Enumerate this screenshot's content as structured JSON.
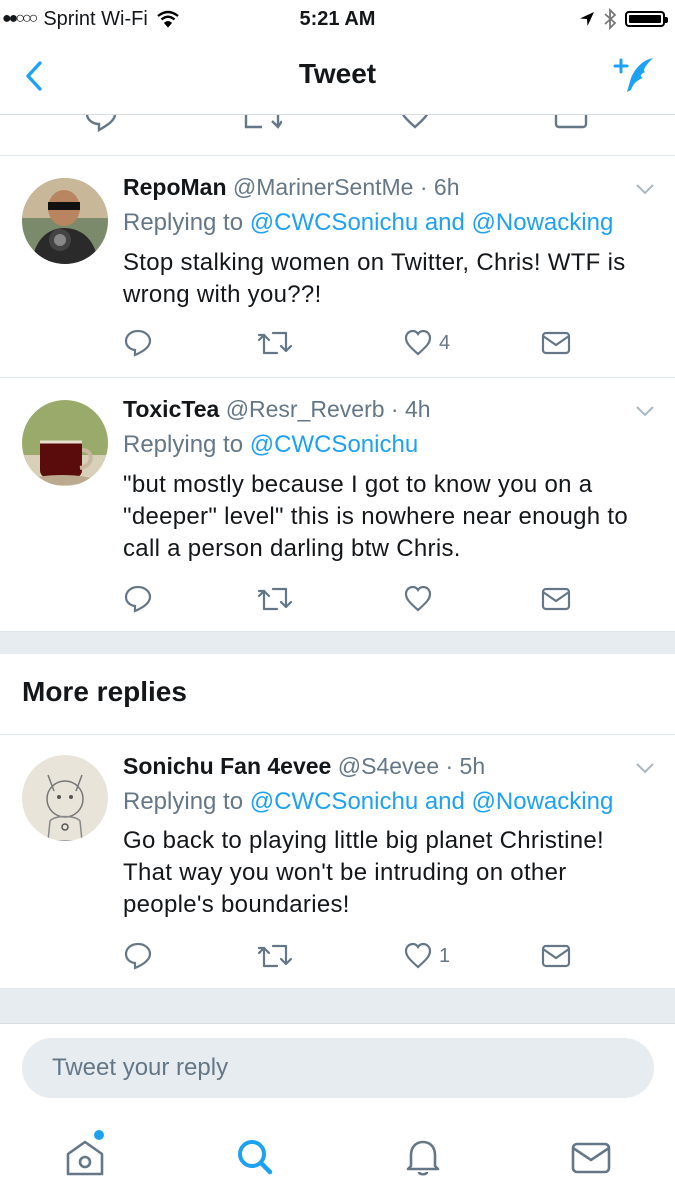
{
  "status_bar": {
    "carrier": "Sprint Wi-Fi",
    "time": "5:21 AM"
  },
  "nav": {
    "title": "Tweet"
  },
  "tweets": [
    {
      "name": "RepoMan",
      "handle": "@MarinerSentMe",
      "time": "· 6h",
      "replying_prefix": "Replying to ",
      "replying_to": "@CWCSonichu and @Nowacking",
      "text": "Stop stalking women on Twitter, Chris! WTF is wrong with you??!",
      "likes": "4"
    },
    {
      "name": "ToxicTea",
      "handle": "@Resr_Reverb",
      "time": "· 4h",
      "replying_prefix": "Replying to ",
      "replying_to": "@CWCSonichu",
      "text": "\"but mostly because I got to know you on a \"deeper\" level\" this is nowhere near enough to call a person darling btw Chris.",
      "likes": ""
    }
  ],
  "more_replies": {
    "title": "More replies",
    "tweets": [
      {
        "name": "Sonichu Fan 4evee",
        "handle": "@S4evee",
        "time": "· 5h",
        "replying_prefix": "Replying to ",
        "replying_to": "@CWCSonichu and @Nowacking",
        "text": "Go back to playing little big planet Christine! That way you won't be intruding on other people's boundaries!",
        "likes": "1"
      }
    ]
  },
  "reply_box": {
    "placeholder": "Tweet your reply"
  },
  "colors": {
    "accent": "#1da1f2",
    "secondary_text": "#657786",
    "divider_band": "#e6ecf0"
  },
  "icons": {
    "back": "chevron-left-icon",
    "compose": "compose-tweet-icon",
    "reply": "reply-icon",
    "retweet": "retweet-icon",
    "like": "heart-icon",
    "dm": "envelope-icon",
    "tab_home": "home-icon",
    "tab_search": "search-icon",
    "tab_notifications": "bell-icon",
    "tab_messages": "envelope-icon"
  }
}
